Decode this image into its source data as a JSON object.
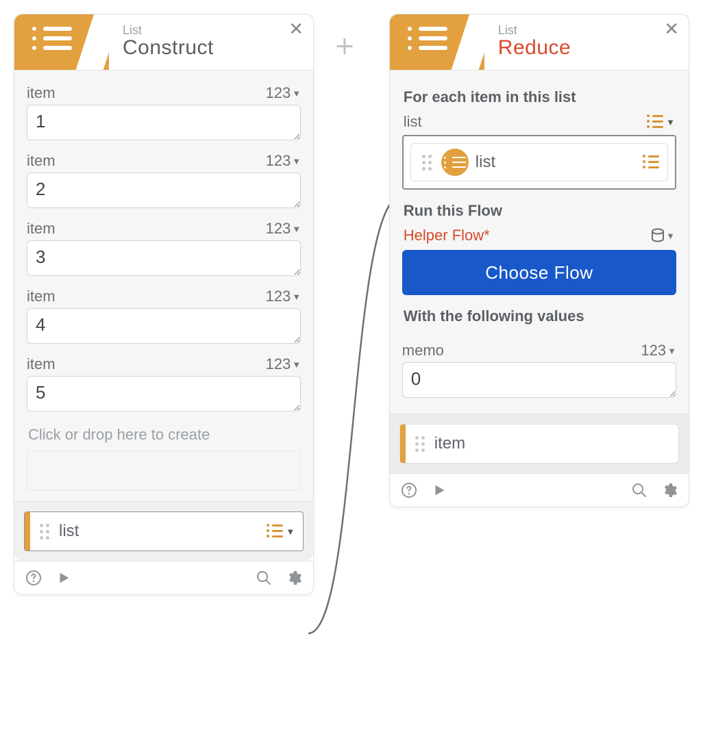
{
  "cards": {
    "construct": {
      "category": "List",
      "title": "Construct",
      "type_tag": "123",
      "items": [
        {
          "label": "item",
          "value": "1"
        },
        {
          "label": "item",
          "value": "2"
        },
        {
          "label": "item",
          "value": "3"
        },
        {
          "label": "item",
          "value": "4"
        },
        {
          "label": "item",
          "value": "5"
        }
      ],
      "drop_hint": "Click or drop here to create",
      "output_label": "list"
    },
    "reduce": {
      "category": "List",
      "title": "Reduce",
      "section1": "For each item in this list",
      "list_label": "list",
      "list_pill_label": "list",
      "section2": "Run this Flow",
      "helper_label": "Helper Flow*",
      "choose_button": "Choose Flow",
      "section3": "With the following values",
      "memo_label": "memo",
      "memo_type": "123",
      "memo_value": "0",
      "output_label": "item"
    }
  }
}
